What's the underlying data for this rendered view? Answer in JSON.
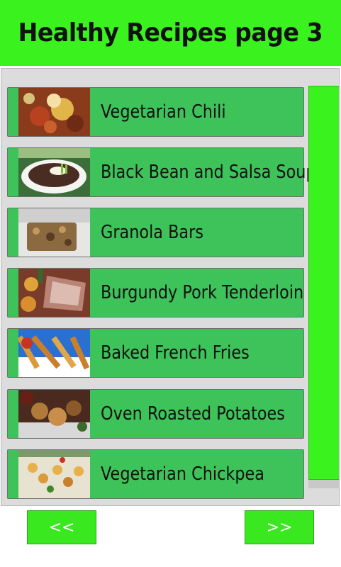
{
  "header": {
    "title": "Healthy Recipes page 3"
  },
  "recipes": [
    {
      "label": "Vegetarian Chili",
      "image": "chili-photo"
    },
    {
      "label": "Black Bean and Salsa Soup",
      "image": "soup-photo"
    },
    {
      "label": "Granola Bars",
      "image": "granola-photo"
    },
    {
      "label": "Burgundy Pork Tenderloin",
      "image": "pork-photo"
    },
    {
      "label": "Baked French Fries",
      "image": "fries-photo"
    },
    {
      "label": "Oven Roasted Potatoes",
      "image": "potatoes-photo"
    },
    {
      "label": "Vegetarian Chickpea",
      "image": "chickpea-photo"
    }
  ],
  "nav": {
    "prev_label": "<<",
    "next_label": ">>"
  },
  "colors": {
    "header": "#39f21e",
    "item": "#3dc359",
    "button": "#39e81e"
  }
}
